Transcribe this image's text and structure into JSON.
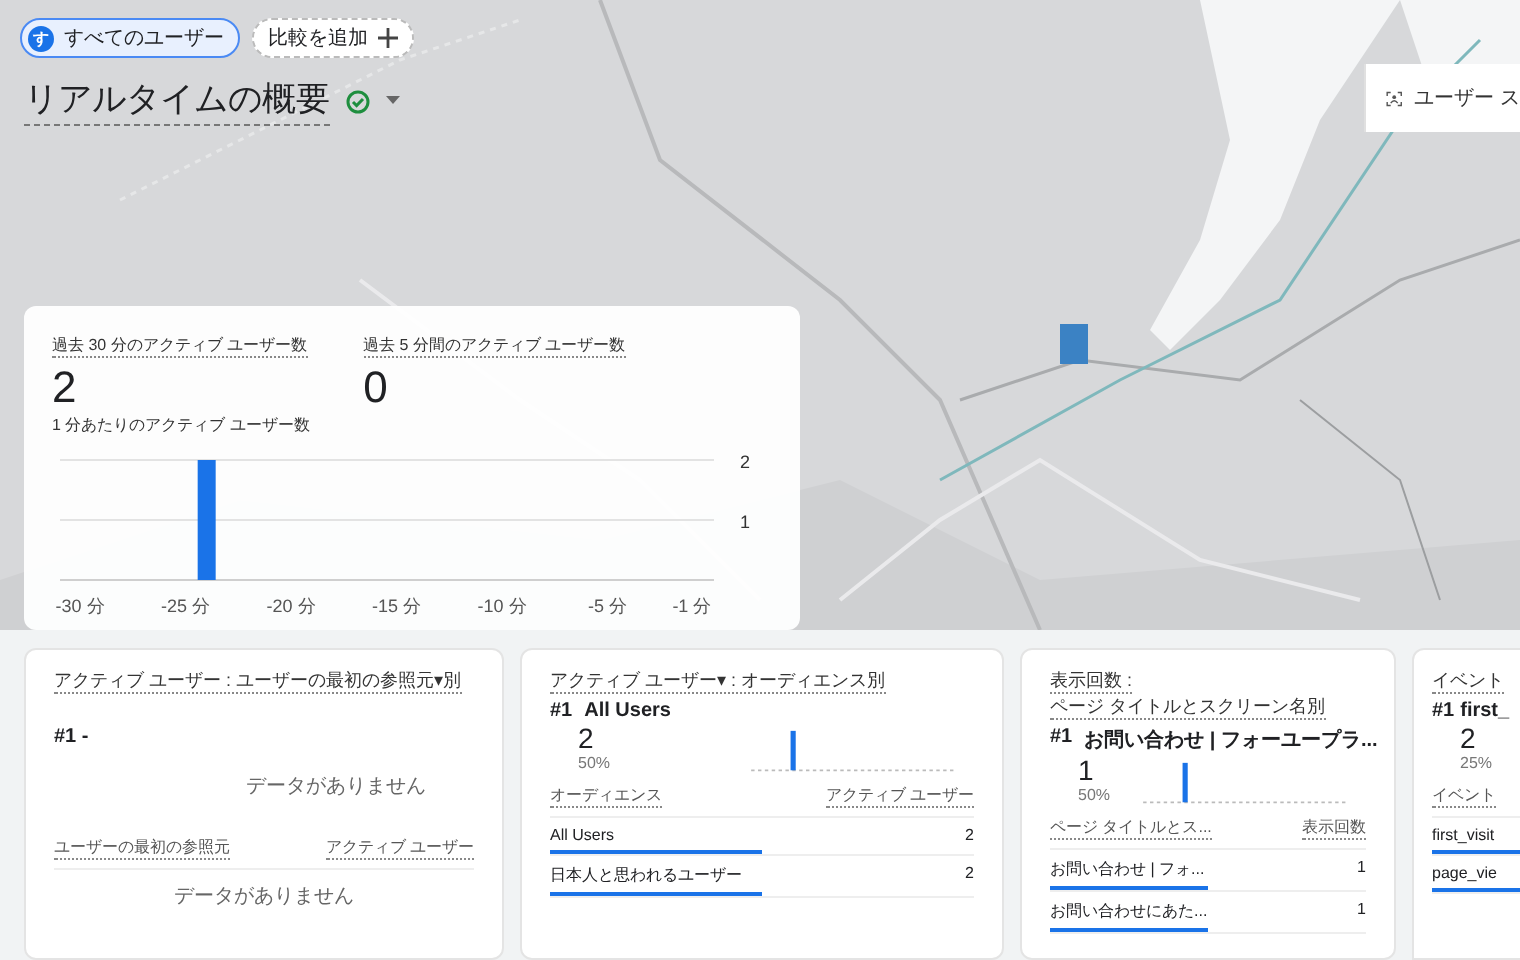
{
  "filters": [
    {
      "kind": "segment",
      "badge": "す",
      "label": "すべてのユーザー"
    },
    {
      "kind": "add",
      "label": "比較を追加"
    }
  ],
  "page_title": "リアルタイムの概要",
  "map_button": {
    "label": "ユーザー ス"
  },
  "summary": {
    "metrics": [
      {
        "label": "過去 30 分のアクティブ ユーザー数",
        "value": "2"
      },
      {
        "label": "過去 5 分間のアクティブ ユーザー数",
        "value": "0"
      }
    ],
    "chart_title": "1 分あたりのアクティブ ユーザー数",
    "chart_data": {
      "type": "bar",
      "x": [
        -30,
        -29,
        -28,
        -27,
        -26,
        -25,
        -24,
        -23,
        -22,
        -21,
        -20,
        -19,
        -18,
        -17,
        -16,
        -15,
        -14,
        -13,
        -12,
        -11,
        -10,
        -9,
        -8,
        -7,
        -6,
        -5,
        -4,
        -3,
        -2,
        -1
      ],
      "values": [
        0,
        0,
        0,
        0,
        0,
        0,
        2,
        0,
        0,
        0,
        0,
        0,
        0,
        0,
        0,
        0,
        0,
        0,
        0,
        0,
        0,
        0,
        0,
        0,
        0,
        0,
        0,
        0,
        0,
        0
      ],
      "xticks": [
        {
          "value": -30,
          "label": "-30 分"
        },
        {
          "value": -25,
          "label": "-25 分"
        },
        {
          "value": -20,
          "label": "-20 分"
        },
        {
          "value": -15,
          "label": "-15 分"
        },
        {
          "value": -10,
          "label": "-10 分"
        },
        {
          "value": -5,
          "label": "-5 分"
        },
        {
          "value": -1,
          "label": "-1 分"
        }
      ],
      "xlim": [
        -31,
        0
      ],
      "yticks": [
        1,
        2
      ],
      "ylim": [
        0,
        2
      ]
    }
  },
  "cards": [
    {
      "kind": "empty",
      "title": [
        "アクティブ ユーザー : ユーザーの最初の参照元▾別"
      ],
      "rank": "#1 -",
      "empty_chart": "データがありません",
      "columns": [
        "ユーザーの最初の参照元",
        "アクティブ ユーザー"
      ],
      "empty_table": "データがありません"
    },
    {
      "kind": "ranked",
      "title": [
        "アクティブ ユーザー▾ : オーディエンス別"
      ],
      "rank": "#1",
      "top": "All Users",
      "value": "2",
      "share": "50%",
      "columns": [
        "オーディエンス",
        "アクティブ ユーザー"
      ],
      "rows": [
        {
          "name": "All Users",
          "value": "2",
          "level": 0.5
        },
        {
          "name": "日本人と思われるユーザー",
          "value": "2",
          "level": 0.5
        }
      ]
    },
    {
      "kind": "ranked",
      "title": [
        "表示回数 :",
        "ページ タイトルとスクリーン名別"
      ],
      "rank": "#1",
      "top": "お問い合わせ | フォーユープラ...",
      "value": "1",
      "share": "50%",
      "columns": [
        "ページ タイトルとス...",
        "表示回数"
      ],
      "rows": [
        {
          "name": "お問い合わせ | フォ...",
          "value": "1",
          "level": 0.5
        },
        {
          "name": "お問い合わせにあた...",
          "value": "1",
          "level": 0.5
        }
      ]
    },
    {
      "kind": "ranked",
      "title": [
        "イベント"
      ],
      "rank": "#1",
      "top": "first_",
      "value": "2",
      "share": "25%",
      "columns": [
        "イベント"
      ],
      "rows": [
        {
          "name": "first_visit",
          "level": 0.5
        },
        {
          "name": "page_vie",
          "level": 0.5
        }
      ]
    }
  ]
}
